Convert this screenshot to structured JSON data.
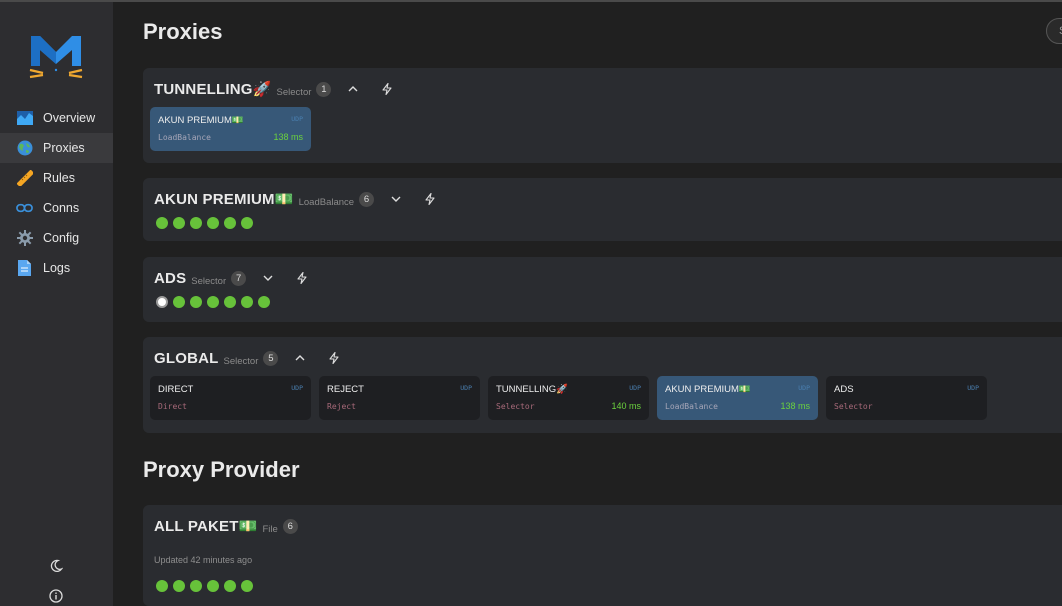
{
  "sidebar": {
    "items": [
      {
        "label": "Overview",
        "icon": "overview-icon"
      },
      {
        "label": "Proxies",
        "icon": "globe-icon"
      },
      {
        "label": "Rules",
        "icon": "ruler-icon"
      },
      {
        "label": "Conns",
        "icon": "link-icon"
      },
      {
        "label": "Config",
        "icon": "gear-icon"
      },
      {
        "label": "Logs",
        "icon": "document-icon"
      }
    ],
    "active": "Proxies"
  },
  "page": {
    "title": "Proxies",
    "settings_label": "S"
  },
  "groups": [
    {
      "name": "TUNNELLING🚀",
      "type": "Selector",
      "count": "1",
      "expanded": true,
      "proxies": [
        {
          "name": "AKUN PREMIUM💵",
          "udp": "UDP",
          "type": "LoadBalance",
          "latency": "138 ms",
          "active": true
        }
      ]
    },
    {
      "name": "AKUN PREMIUM💵",
      "type": "LoadBalance",
      "count": "6",
      "expanded": false,
      "dots": 6,
      "selected_dot": -1
    },
    {
      "name": "ADS",
      "type": "Selector",
      "count": "7",
      "expanded": false,
      "dots": 7,
      "selected_dot": 0
    },
    {
      "name": "GLOBAL",
      "type": "Selector",
      "count": "5",
      "expanded": true,
      "proxies": [
        {
          "name": "DIRECT",
          "udp": "UDP",
          "type": "Direct",
          "latency": "",
          "active": false
        },
        {
          "name": "REJECT",
          "udp": "UDP",
          "type": "Reject",
          "latency": "",
          "active": false
        },
        {
          "name": "TUNNELLING🚀",
          "udp": "UDP",
          "type": "Selector",
          "latency": "140 ms",
          "active": false
        },
        {
          "name": "AKUN PREMIUM💵",
          "udp": "UDP",
          "type": "LoadBalance",
          "latency": "138 ms",
          "active": true
        },
        {
          "name": "ADS",
          "udp": "UDP",
          "type": "Selector",
          "latency": "",
          "active": false
        }
      ]
    }
  ],
  "provider": {
    "section_title": "Proxy Provider",
    "name": "ALL PAKET💵",
    "type": "File",
    "count": "6",
    "updated": "Updated 42 minutes ago",
    "dots": 6
  },
  "colors": {
    "accent": "#375878",
    "latency_good": "#67c23a",
    "background": "#202020",
    "sidebar": "#2d2d30",
    "card": "#2a2c30"
  }
}
